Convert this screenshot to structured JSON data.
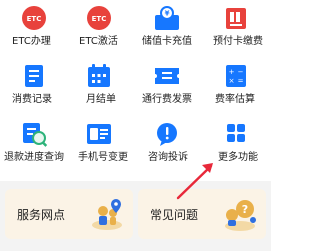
{
  "accent_color": "#1677ff",
  "red_color": "#e8423c",
  "grid": {
    "items": [
      {
        "label": "ETC办理",
        "icon": "etc-round-icon"
      },
      {
        "label": "ETC激活",
        "icon": "etc-round-icon"
      },
      {
        "label": "储值卡充值",
        "icon": "card-recharge-icon"
      },
      {
        "label": "预付卡缴费",
        "icon": "prepaid-card-icon"
      },
      {
        "label": "消费记录",
        "icon": "document-list-icon"
      },
      {
        "label": "月结单",
        "icon": "calendar-icon"
      },
      {
        "label": "通行费发票",
        "icon": "ticket-invoice-icon"
      },
      {
        "label": "费率估算",
        "icon": "calculator-icon"
      },
      {
        "label": "退款进度查询",
        "icon": "search-magnifier-icon"
      },
      {
        "label": "手机号变更",
        "icon": "phone-card-icon"
      },
      {
        "label": "咨询投诉",
        "icon": "alert-bubble-icon"
      },
      {
        "label": "更多功能",
        "icon": "more-grid-icon"
      }
    ]
  },
  "cards": {
    "service_outlets": "服务网点",
    "faq": "常见问题"
  }
}
